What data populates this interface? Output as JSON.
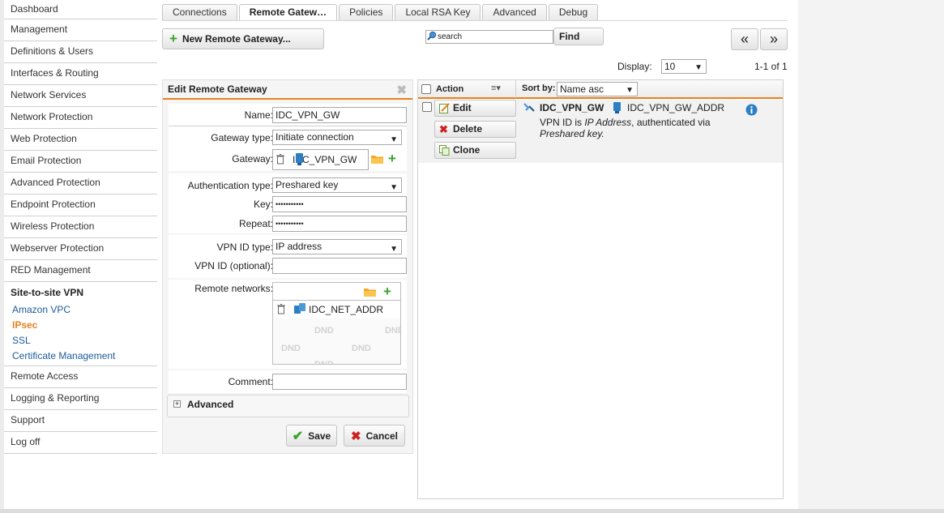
{
  "sidebar": {
    "items_top": [
      "Dashboard",
      "Management",
      "Definitions & Users",
      "Interfaces & Routing",
      "Network Services",
      "Network Protection",
      "Web Protection",
      "Email Protection",
      "Advanced Protection",
      "Endpoint Protection",
      "Wireless Protection",
      "Webserver Protection",
      "RED Management"
    ],
    "group": {
      "title": "Site-to-site VPN",
      "subitems": [
        "Amazon VPC",
        "IPsec",
        "SSL",
        "Certificate Management"
      ],
      "active": "IPsec"
    },
    "items_bottom": [
      "Remote Access",
      "Logging & Reporting",
      "Support",
      "Log off"
    ]
  },
  "tabs": [
    "Connections",
    "Remote Gatew…",
    "Policies",
    "Local RSA Key",
    "Advanced",
    "Debug"
  ],
  "toolbar": {
    "new_label": "New Remote Gateway...",
    "search_placeholder": "search",
    "search_value": "search",
    "find_label": "Find",
    "prev_label": "«",
    "next_label": "»",
    "display_label": "Display:",
    "display_value": "10",
    "range_label": "1-1 of 1"
  },
  "edit": {
    "title": "Edit Remote Gateway",
    "name_label": "Name:",
    "name_value": "IDC_VPN_GW",
    "gateway_type_label": "Gateway type:",
    "gateway_type_value": "Initiate connection",
    "gateway_label": "Gateway:",
    "gateway_value": "IDC_VPN_GW",
    "auth_type_label": "Authentication type:",
    "auth_type_value": "Preshared key",
    "key_label": "Key:",
    "key_value": "•••••••••••",
    "repeat_label": "Repeat:",
    "repeat_value": "•••••••••••",
    "vpn_id_type_label": "VPN ID type:",
    "vpn_id_type_value": "IP address",
    "vpn_id_label": "VPN ID (optional):",
    "vpn_id_value": "",
    "remote_networks_label": "Remote networks:",
    "remote_network_item": "IDC_NET_ADDR",
    "dnd": "DND",
    "comment_label": "Comment:",
    "comment_value": "",
    "advanced_label": "Advanced",
    "save_label": "Save",
    "cancel_label": "Cancel"
  },
  "list": {
    "action_label": "Action",
    "sortby_label": "Sort by:",
    "sortby_value": "Name asc",
    "edit_label": "Edit",
    "delete_label": "Delete",
    "clone_label": "Clone",
    "entry_name": "IDC_VPN_GW",
    "entry_host": "IDC_VPN_GW_ADDR",
    "desc_line1_a": "VPN ID is ",
    "desc_line1_b": "IP Address",
    "desc_line1_c": ", authenticated via",
    "desc_line2": "Preshared key."
  },
  "colors": {
    "accent": "#e8801c",
    "link": "#1c5b9a",
    "add_green": "#3aa22b",
    "delete_red": "#cc2222"
  }
}
